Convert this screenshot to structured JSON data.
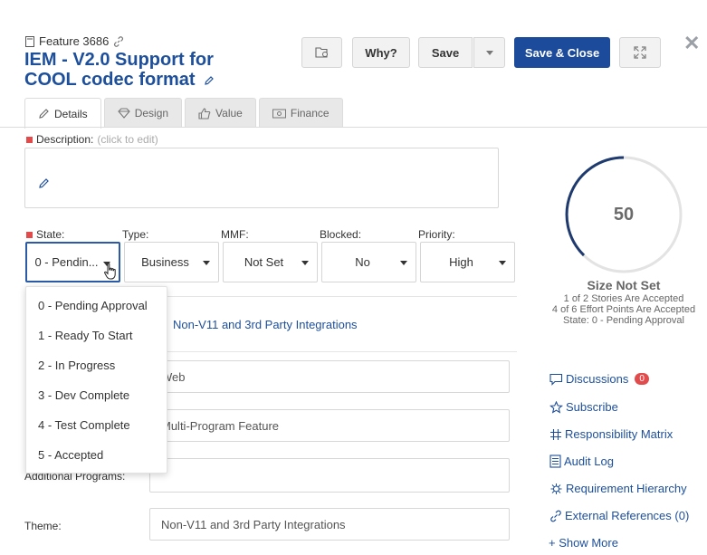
{
  "header": {
    "feature_id": "Feature 3686",
    "title": "IEM - V2.0 Support for COOL codec format",
    "why_label": "Why?",
    "save_label": "Save",
    "save_close_label": "Save & Close"
  },
  "tabs": [
    {
      "label": "Details",
      "icon": "pencil-icon"
    },
    {
      "label": "Design",
      "icon": "diamond-icon"
    },
    {
      "label": "Value",
      "icon": "thumbs-up-icon"
    },
    {
      "label": "Finance",
      "icon": "money-icon"
    }
  ],
  "description": {
    "label": "Description:",
    "hint": "(click to edit)"
  },
  "fields": {
    "state": {
      "label": "State:",
      "value": "0 - Pendin..."
    },
    "type": {
      "label": "Type:",
      "value": "Business"
    },
    "mmf": {
      "label": "MMF:",
      "value": "Not Set"
    },
    "blocked": {
      "label": "Blocked:",
      "value": "No"
    },
    "priority": {
      "label": "Priority:",
      "value": "High"
    }
  },
  "state_options": [
    "0 - Pending Approval",
    "1 - Ready To Start",
    "2 - In Progress",
    "3 - Dev Complete",
    "4 - Test Complete",
    "5 - Accepted"
  ],
  "form": {
    "theme_link": "Non-V11 and 3rd Party Integrations",
    "field_web": "Web",
    "field_program": "Multi-Program Feature",
    "additional_programs_label": "Additional Programs:",
    "theme_label": "Theme:",
    "theme_value": "Non-V11 and 3rd Party Integrations"
  },
  "size": {
    "value": "50",
    "title": "Size Not Set",
    "line1": "1 of 2 Stories Are Accepted",
    "line2": "4 of 6 Effort Points Are Accepted",
    "line3": "State: 0 - Pending Approval"
  },
  "side_links": {
    "discussions": "Discussions",
    "discussions_count": "0",
    "subscribe": "Subscribe",
    "responsibility": "Responsibility Matrix",
    "audit": "Audit Log",
    "hierarchy": "Requirement Hierarchy",
    "external": "External References (0)",
    "show_more": "+ Show More"
  },
  "colors": {
    "accent": "#1c4b9c",
    "link": "#1d4f9b",
    "required": "#e24b4b"
  }
}
